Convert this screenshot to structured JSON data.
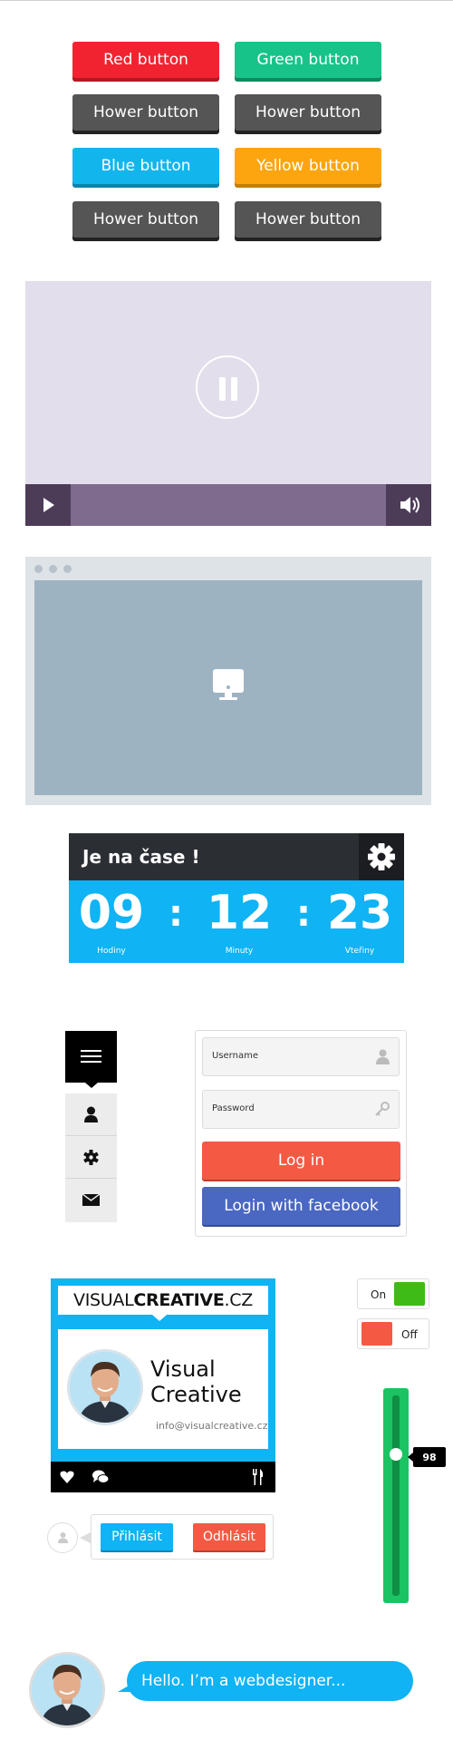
{
  "buttons": {
    "red_label": "Red button",
    "green_label": "Green button",
    "hover1_label": "Hower button",
    "hover2_label": "Hower button",
    "blue_label": "Blue button",
    "yellow_label": "Yellow button",
    "hover3_label": "Hower button",
    "hover4_label": "Hower button"
  },
  "colors": {
    "red": "#f22331",
    "green": "#17c389",
    "grey": "#555555",
    "blue": "#13b5ed",
    "yellow": "#fca50f",
    "facebook": "#4a67c2",
    "login": "#f45a43",
    "slider_green": "#1cc363"
  },
  "video": {
    "pause_icon": "pause-icon",
    "play_icon": "play-icon",
    "volume_icon": "volume-icon"
  },
  "browser": {
    "monitor_icon": "monitor-icon"
  },
  "timer": {
    "title": "Je na čase !",
    "hours": "09",
    "minutes": "12",
    "seconds": "23",
    "sep": ":",
    "hours_label": "Hodiny",
    "minutes_label": "Minuty",
    "seconds_label": "Vteřiny"
  },
  "login": {
    "username_placeholder": "Username",
    "password_placeholder": "Password",
    "login_label": "Log in",
    "facebook_label": "Login with facebook"
  },
  "card": {
    "brand_light": "VISUAL",
    "brand_bold": "CREATIVE",
    "brand_tail": ".CZ",
    "name_line1": "Visual",
    "name_line2": "Creative",
    "email": "info@visualcreative.cz"
  },
  "toggles": {
    "on_label": "On",
    "off_label": "Off"
  },
  "slider": {
    "value": "98"
  },
  "auth": {
    "signin_label": "Přihlásit",
    "signout_label": "Odhlásit"
  },
  "chat": {
    "message": "Hello. I’m a webdesigner..."
  }
}
